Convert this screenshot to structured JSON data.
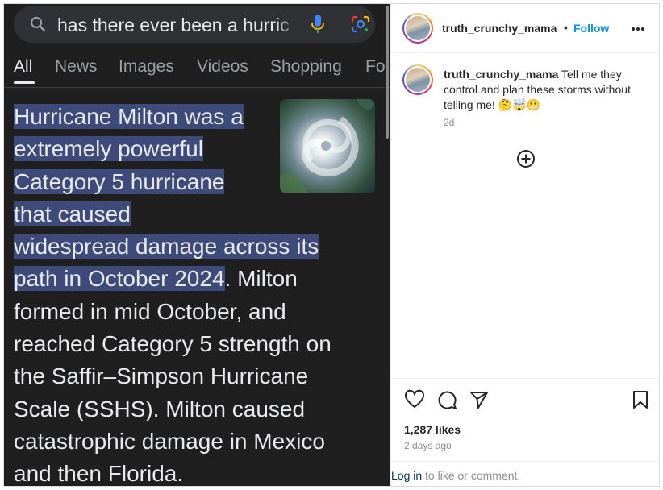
{
  "media": {
    "search": {
      "query": "has there ever been a hurric"
    },
    "tabs": [
      {
        "label": "All"
      },
      {
        "label": "News"
      },
      {
        "label": "Images"
      },
      {
        "label": "Videos"
      },
      {
        "label": "Shopping"
      },
      {
        "label": "Fo"
      }
    ],
    "snippet": {
      "lines_highlighted": [
        "Hurricane Milton was a",
        "extremely powerful",
        "Category 5 hurricane",
        "that caused",
        "widespread damage across its"
      ],
      "line6_highlighted": "path in October 2024",
      "line6_rest": ". Milton",
      "lines_plain": [
        "formed in mid October, and",
        "reached Category 5 strength on",
        "the Saffir–Simpson Hurricane",
        "Scale (SSHS). Milton caused",
        "catastrophic damage in Mexico",
        "and then Florida."
      ]
    }
  },
  "header": {
    "username": "truth_crunchy_mama",
    "separator": "•",
    "follow_label": "Follow"
  },
  "caption": {
    "username": "truth_crunchy_mama",
    "text": "Tell me they control and plan these storms without telling me! 🤔🤯😬",
    "time_ago": "2d"
  },
  "footer": {
    "likes": "1,287 likes",
    "date": "2 days ago",
    "login_link": "Log in",
    "login_rest": " to like or comment."
  },
  "colors": {
    "follow": "#0095f6",
    "highlight": "#3d4a7a",
    "dark_bg": "#1f1f1f"
  }
}
